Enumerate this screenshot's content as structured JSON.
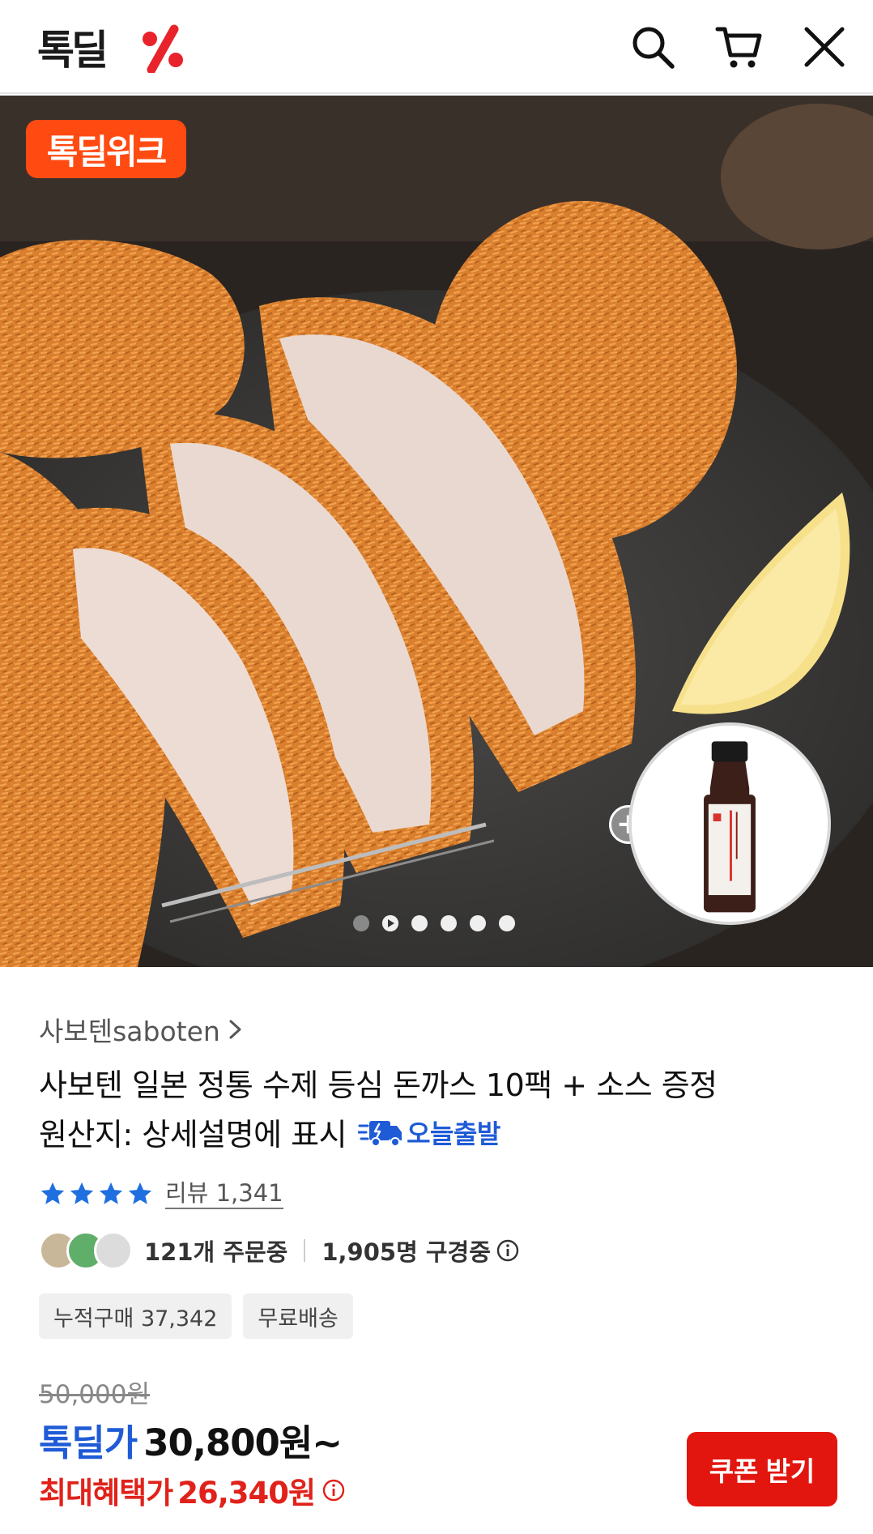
{
  "header": {
    "logo_text": "톡딜",
    "icons": [
      "search-icon",
      "cart-icon",
      "close-icon"
    ],
    "colors": {
      "logo_accent": "#e8232b"
    }
  },
  "hero": {
    "badge_label": "톡딜위크",
    "plus_symbol": "+",
    "carousel": {
      "total": 6,
      "current": 2,
      "video_slide": 2
    }
  },
  "product": {
    "brand": "사보텐saboten",
    "brand_chevron": "›",
    "title": "사보텐 일본 정통 수제 등심 돈까스 10팩 + 소스 증정",
    "origin": "원산지: 상세설명에 표시",
    "shipping_badge": "오늘출발",
    "rating": {
      "stars": 4,
      "review_label": "리뷰 1,341"
    },
    "ordering": "121개 주문중",
    "browsing": "1,905명 구경중",
    "chips": [
      "누적구매 37,342",
      "무료배송"
    ],
    "original_price": "50,000원",
    "deal_label": "톡딜가",
    "deal_price": "30,800원~",
    "max_label": "최대혜택가",
    "max_price": "26,340원",
    "coupon_button": "쿠폰 받기"
  },
  "colors": {
    "brand_blue": "#1f5bd6",
    "sale_red": "#e0221b",
    "badge_orange": "#ff4b12",
    "star_blue": "#1f6fe0"
  }
}
